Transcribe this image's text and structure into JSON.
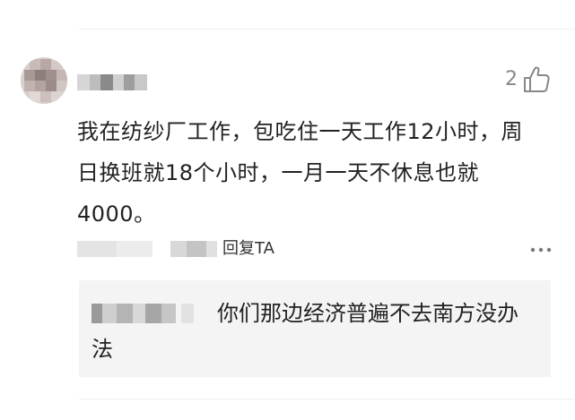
{
  "comment": {
    "like_count": "2",
    "text": "我在纺纱厂工作，包吃住一天工作12小时，周日换班就18个小时，一月一天不休息也就4000。",
    "reply_label": "回复TA"
  },
  "reply": {
    "text": "你们那边经济普遍不去南方没办法"
  },
  "icons": {
    "like": "thumbs-up-icon",
    "more": "more-dots-icon",
    "avatar": "blurred-avatar"
  },
  "colors": {
    "like_count": "#888888",
    "reply_background": "#f4f4f4",
    "text": "#222222"
  }
}
